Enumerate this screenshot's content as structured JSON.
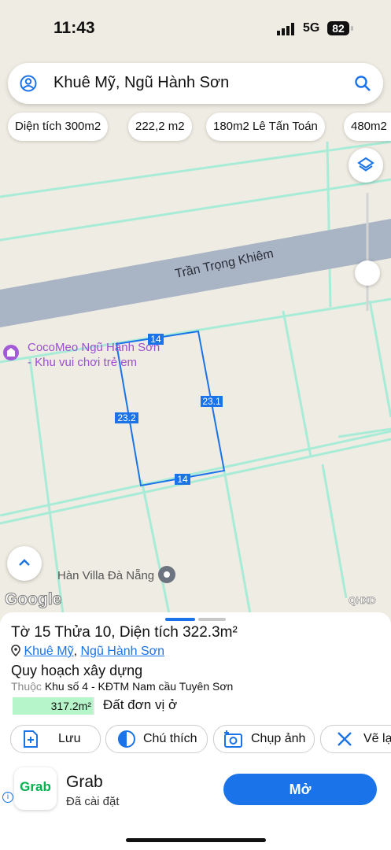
{
  "status_bar": {
    "time": "11:43",
    "network": "5G",
    "battery": "82"
  },
  "search": {
    "text": "Khuê Mỹ, Ngũ Hành Sơn"
  },
  "chips": [
    "Diện tích 300m2",
    "222,2 m2",
    "180m2 Lê Tấn Toán",
    "480m2"
  ],
  "map": {
    "street_name": "Trần Trọng Khiêm",
    "poi_1_line1": "CocoMeo Ngũ Hành Sơn",
    "poi_1_line2": "- Khu vui chơi trẻ em",
    "poi_2": "Hàn Villa Đà Nẵng",
    "parcel_labels": {
      "top": "14",
      "right": "23.1",
      "left": "23.2",
      "bottom": "14"
    },
    "google_logo": "Google",
    "layer_tag": "QHXD"
  },
  "sheet": {
    "title": "Tờ 15 Thửa 10, Diện tích 322.3m²",
    "ward": "Khuê Mỹ",
    "separator": ", ",
    "district": "Ngũ Hành Sơn",
    "plan_title": "Quy hoạch xây dựng",
    "zone_prefix": "Thuộc",
    "zone": "Khu số 4 - KĐTM Nam cầu Tuyên Sơn",
    "area_label": "317.2m²",
    "area_fraction": 0.984,
    "land_use": "Đất đơn vị ở",
    "actions": {
      "save": "Lưu",
      "note": "Chú thích",
      "photo": "Chụp ảnh",
      "draw": "Vẽ lại"
    }
  },
  "ad": {
    "logo": "Grab",
    "name": "Grab",
    "subtitle": "Đã cài đặt",
    "button": "Mở",
    "info": "i"
  },
  "colors": {
    "accent": "#1a73e8",
    "grid_line": "#a8ecd8",
    "road": "#a9b4c4",
    "map_bg": "#efece3"
  }
}
